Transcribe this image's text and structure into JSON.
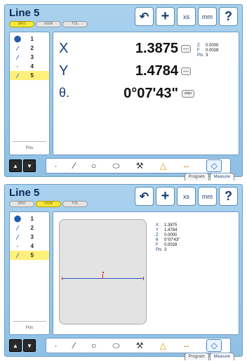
{
  "title": "Line 5",
  "mode_tabs": [
    "DRO",
    "VIEW",
    "TOL"
  ],
  "toolbar": {
    "xs_label": "xs",
    "mm_label": "mm",
    "help_label": "?"
  },
  "features": [
    {
      "num": "1",
      "icon": "probe-icon"
    },
    {
      "num": "2",
      "icon": "line-icon"
    },
    {
      "num": "3",
      "icon": "line-icon"
    },
    {
      "num": "4",
      "icon": "point-icon"
    },
    {
      "num": "5",
      "icon": "line-icon",
      "selected": true
    }
  ],
  "side_label": "Pos",
  "dro": {
    "x": {
      "label": "X",
      "value": "1.3875"
    },
    "y": {
      "label": "Y",
      "value": "1.4784"
    },
    "theta": {
      "label": "θ.",
      "value": "0°07'43\"",
      "button": "align"
    },
    "z": {
      "label": "Z",
      "value": "0.0000"
    },
    "f": {
      "label": "F",
      "value": "0.0028"
    },
    "pts": {
      "label": "Pts",
      "value": "3"
    }
  },
  "view_stats": [
    {
      "k": "X",
      "v": "1.3875"
    },
    {
      "k": "Y",
      "v": "1.4784"
    },
    {
      "k": "Z",
      "v": "0.0000"
    },
    {
      "k": "θ",
      "v": "0°07'43\""
    },
    {
      "k": "F",
      "v": "0.0028"
    },
    {
      "k": "Pts",
      "v": "3"
    }
  ],
  "view_tabs": [
    "Program",
    "Measure"
  ],
  "colors": {
    "accent": "#8fc0e4",
    "selected_row": "#fff07a",
    "active_tab": "#f7e83a"
  }
}
